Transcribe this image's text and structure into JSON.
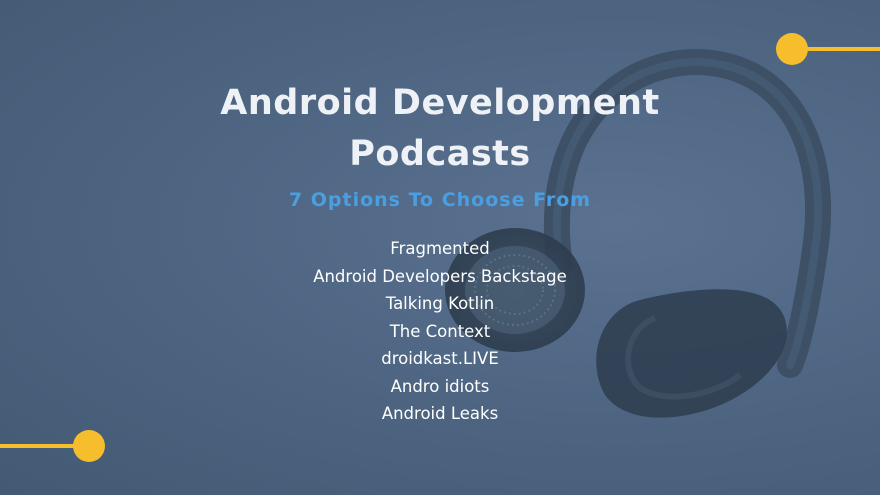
{
  "slide": {
    "title_line1": "Android Development",
    "title_line2": "Podcasts",
    "subtitle": "7 Options To Choose From",
    "podcasts": [
      "Fragmented",
      "Android Developers Backstage",
      "Talking Kotlin",
      "The Context",
      "droidkast.LIVE",
      "Andro idiots",
      "Android Leaks"
    ]
  },
  "colors": {
    "background": "#4d6580",
    "accent_yellow": "#f6bd2c",
    "subtitle_blue": "#4a9fe3",
    "title_text": "#eef1f5"
  },
  "icons": {
    "background_image": "headphones-icon",
    "decoration": "dot-line-icon"
  }
}
